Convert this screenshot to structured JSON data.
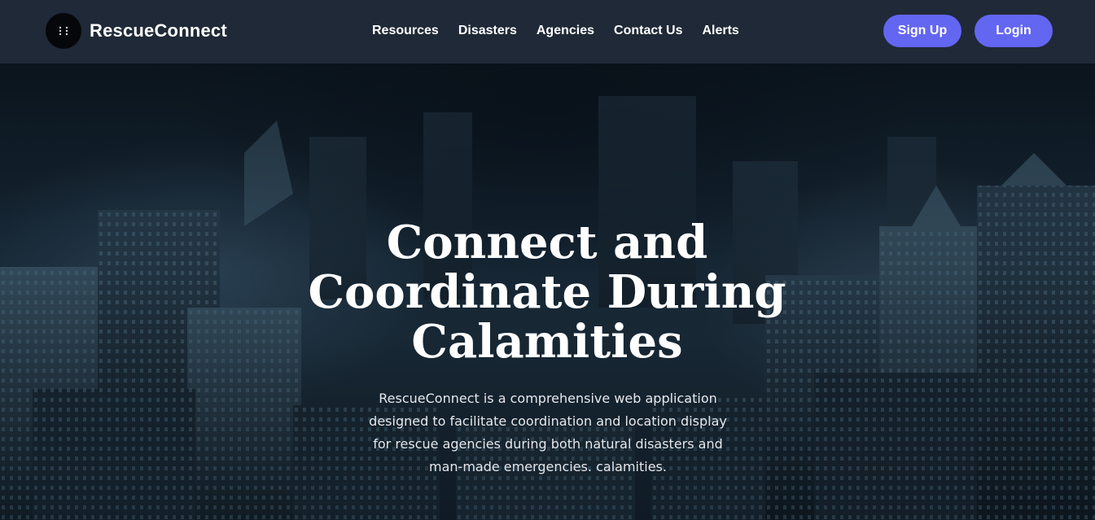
{
  "brand": {
    "name": "RescueConnect",
    "logo_icon": "grid-dots-icon"
  },
  "nav": {
    "items": [
      {
        "label": "Resources"
      },
      {
        "label": "Disasters"
      },
      {
        "label": "Agencies"
      },
      {
        "label": "Contact Us"
      },
      {
        "label": "Alerts"
      }
    ]
  },
  "auth": {
    "signup_label": "Sign Up",
    "login_label": "Login"
  },
  "hero": {
    "title": "Connect and Coordinate During Calamities",
    "description": "RescueConnect is a comprehensive web application designed to facilitate coordination and location display for rescue agencies during both natural disasters and man-made emergencies. calamities."
  },
  "colors": {
    "header_bg": "#1f2937",
    "accent": "#6366f1",
    "text_primary": "#ffffff",
    "text_secondary": "#e5e7eb"
  }
}
